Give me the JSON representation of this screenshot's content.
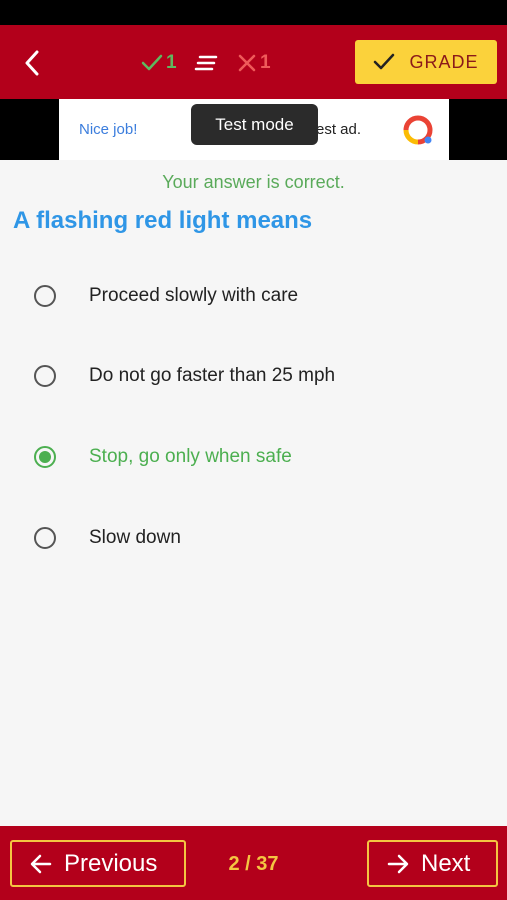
{
  "header": {
    "correct_count": "1",
    "wrong_count": "1",
    "grade_label": "GRADE"
  },
  "ad": {
    "left_text": "Nice job!",
    "right_text": "est ad.",
    "tooltip": "Test mode"
  },
  "feedback": "Your answer is correct.",
  "question": "A flashing red light means",
  "options": [
    {
      "label": "Proceed slowly with care",
      "selected": false
    },
    {
      "label": "Do not go faster than 25 mph",
      "selected": false
    },
    {
      "label": "Stop, go only when safe",
      "selected": true
    },
    {
      "label": "Slow down",
      "selected": false
    }
  ],
  "footer": {
    "previous_label": "Previous",
    "next_label": "Next",
    "page": "2 / 37"
  },
  "colors": {
    "primary": "#b3001b",
    "grade_button": "#fbd23b",
    "correct": "#4caf50",
    "question": "#2f96e6",
    "accent": "#f4c542"
  }
}
